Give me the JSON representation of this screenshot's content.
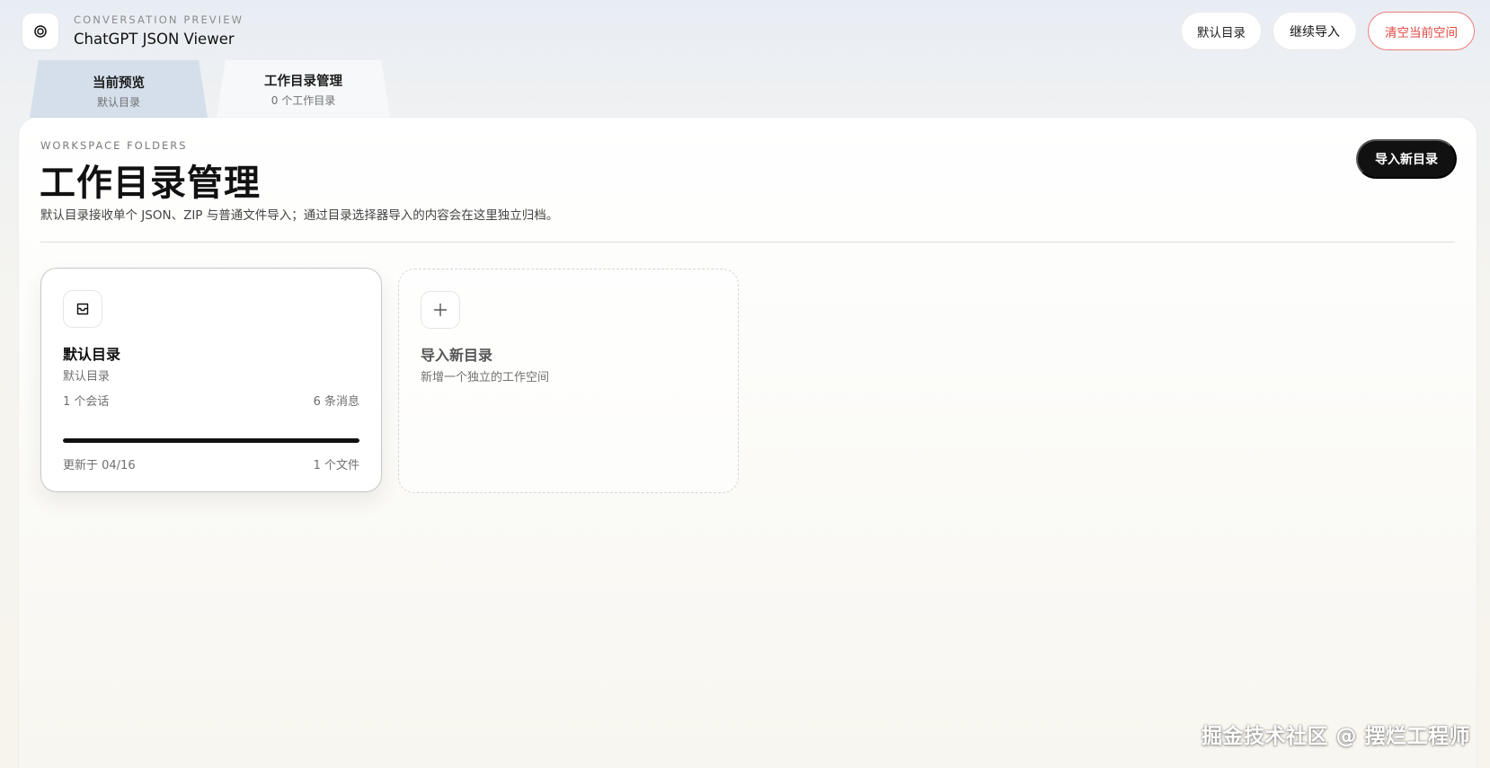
{
  "header": {
    "kicker": "CONVERSATION PREVIEW",
    "title": "ChatGPT JSON Viewer",
    "logo_icon": "target-icon",
    "actions": {
      "default_dir": "默认目录",
      "continue_import": "继续导入",
      "clear_space": "清空当前空间"
    }
  },
  "tabs": {
    "preview": {
      "label": "当前预览",
      "sub": "默认目录"
    },
    "folders": {
      "label": "工作目录管理",
      "sub": "0 个工作目录"
    }
  },
  "section": {
    "kicker": "WORKSPACE FOLDERS",
    "title": "工作目录管理",
    "description": "默认目录接收单个 JSON、ZIP 与普通文件导入；通过目录选择器导入的内容会在这里独立归档。",
    "import_button": "导入新目录"
  },
  "folder_card": {
    "icon": "inbox-icon",
    "name": "默认目录",
    "subtitle": "默认目录",
    "conversations": "1 个会话",
    "messages": "6 条消息",
    "progress": 1.0,
    "updated": "更新于 04/16",
    "files": "1 个文件"
  },
  "new_folder_card": {
    "icon": "plus-icon",
    "title": "导入新目录",
    "subtitle": "新增一个独立的工作空间"
  },
  "watermark": "掘金技术社区 @ 摆烂工程师",
  "colors": {
    "active_tab": "#d4dfeb",
    "danger": "#e0463f",
    "primary_button": "#111111"
  }
}
